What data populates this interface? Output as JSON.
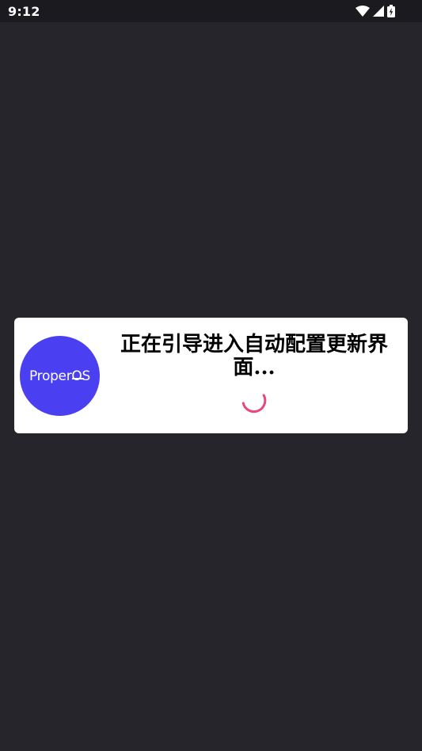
{
  "status_bar": {
    "time": "9:12",
    "icons": [
      "wifi-icon",
      "cellular-signal-icon",
      "battery-charging-icon"
    ]
  },
  "dialog": {
    "logo_text": "ProperOS",
    "message": "正在引导进入自动配置更新界面...",
    "spinner_icon": "loading-spinner-icon"
  },
  "colors": {
    "background": "#26252b",
    "status_bar": "#1b1b1f",
    "dialog": "#ffffff",
    "logo": "#4a40f2",
    "spinner": "#e8487a"
  }
}
